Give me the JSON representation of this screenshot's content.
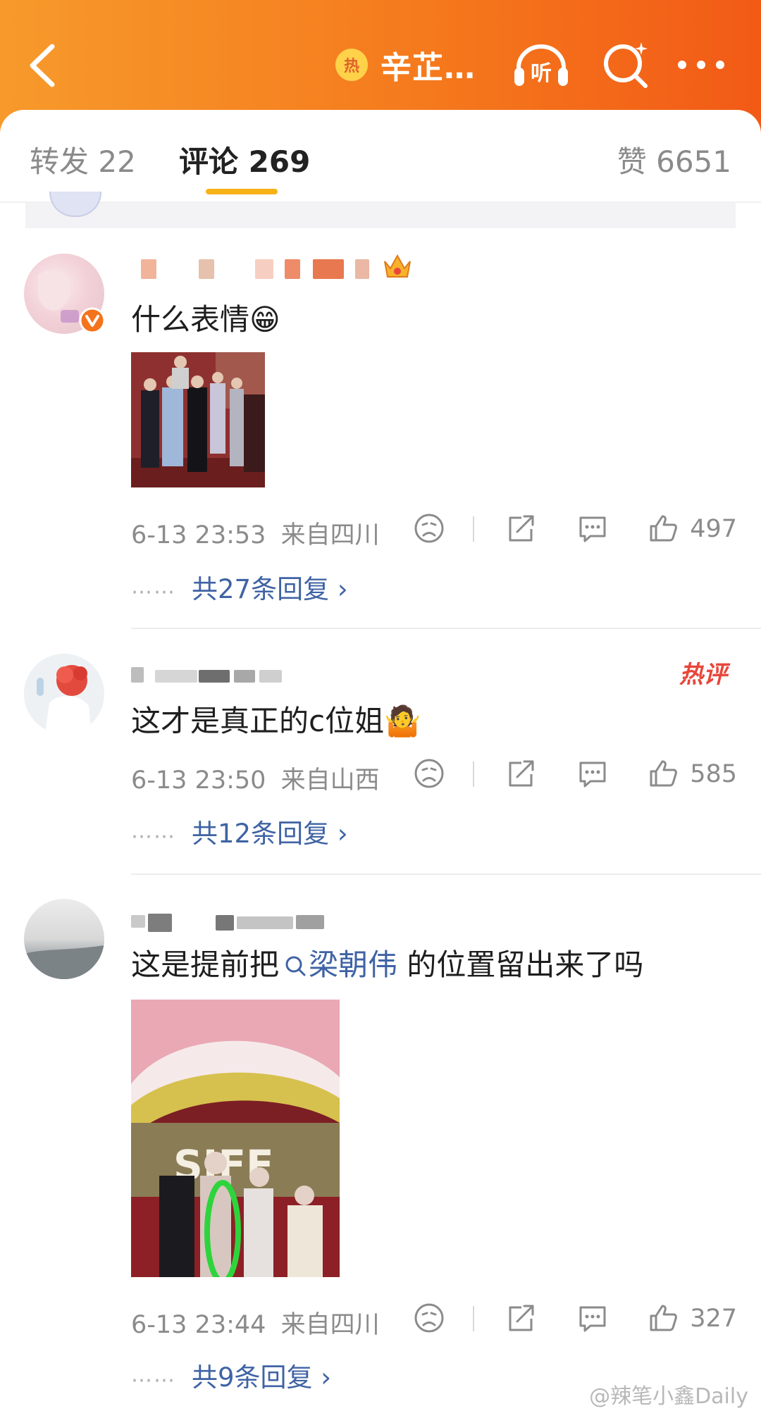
{
  "header": {
    "hot_badge": "热",
    "topic_title": "辛芷…",
    "listen_label": "听"
  },
  "tabs": {
    "repost": "转发 22",
    "comments": "评论 269",
    "likes": "赞 6651"
  },
  "comments": [
    {
      "text": "什么表情",
      "emoji": "😁",
      "time": "6-13 23:53",
      "location": "来自四川",
      "likes": "497",
      "replies": "共27条回复 ›",
      "reply_dots": "……"
    },
    {
      "text": "这才是真正的c位姐",
      "emoji": "🤷",
      "hot_label": "热评",
      "time": "6-13 23:50",
      "location": "来自山西",
      "likes": "585",
      "replies": "共12条回复 ›",
      "reply_dots": "……"
    },
    {
      "text_before": "这是提前把",
      "mention": "梁朝伟",
      "text_after": " 的位置留出来了吗",
      "image_sign": "SIFF",
      "time": "6-13 23:44",
      "location": "来自四川",
      "likes": "327",
      "replies": "共9条回复 ›",
      "reply_dots": "……"
    }
  ],
  "watermark": "@辣笔小鑫Daily",
  "colors": {
    "header_start": "#f79a2b",
    "header_end": "#f25a16",
    "tab_underline": "#f7b218",
    "link_blue": "#3f63a4",
    "hot_red": "#e8463b"
  }
}
